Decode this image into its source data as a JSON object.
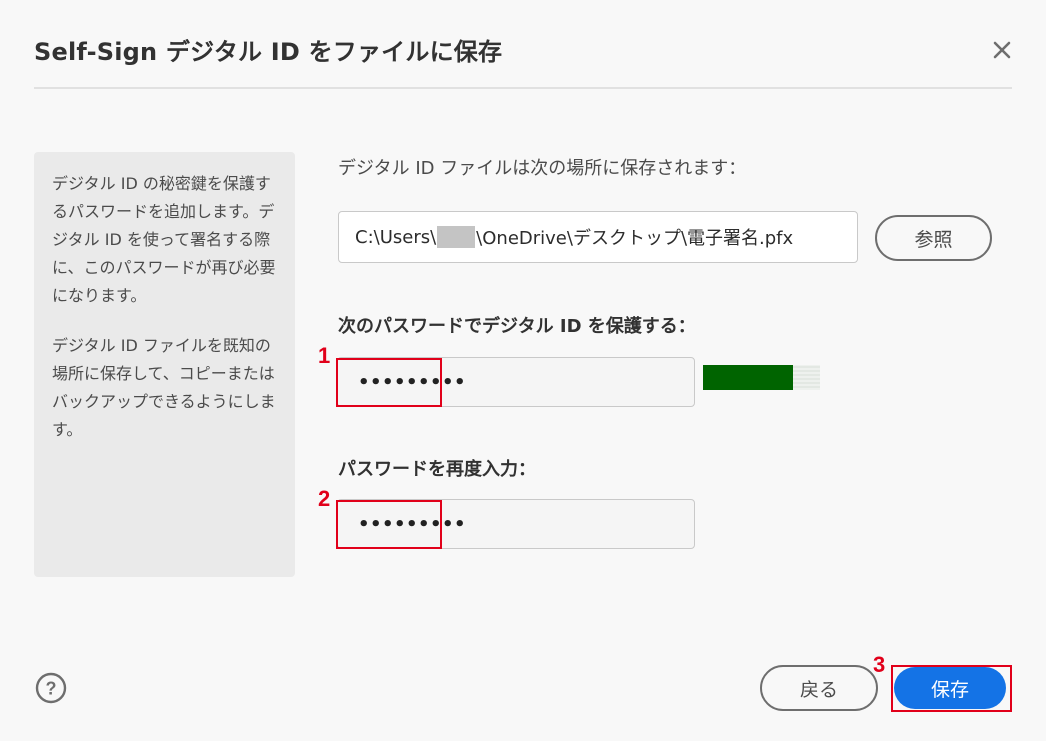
{
  "dialog": {
    "title": "Self-Sign デジタル ID をファイルに保存",
    "close_icon": "close-icon"
  },
  "info_panel": {
    "paragraph1": "デジタル ID の秘密鍵を保護するパスワードを追加します。デジタル ID を使って署名する際に、このパスワードが再び必要になります。",
    "paragraph2": "デジタル ID ファイルを既知の場所に保存して、コピーまたはバックアップできるようにします。"
  },
  "location": {
    "label": "デジタル ID ファイルは次の場所に保存されます：",
    "path_prefix": "C:\\Users\\",
    "path_suffix": "\\OneDrive\\デスクトップ\\電子署名.pfx",
    "browse_label": "参照"
  },
  "password": {
    "label": "次のパスワードでデジタル ID を保護する：",
    "value": "•••••••••",
    "strength_color": "#006400"
  },
  "confirm": {
    "label": "パスワードを再度入力：",
    "value": "•••••••••"
  },
  "annotations": {
    "step1": "1",
    "step2": "2",
    "step3": "3",
    "color": "#e1001a"
  },
  "footer": {
    "help_icon": "help-icon",
    "back_label": "戻る",
    "save_label": "保存",
    "accent": "#1473e6"
  }
}
